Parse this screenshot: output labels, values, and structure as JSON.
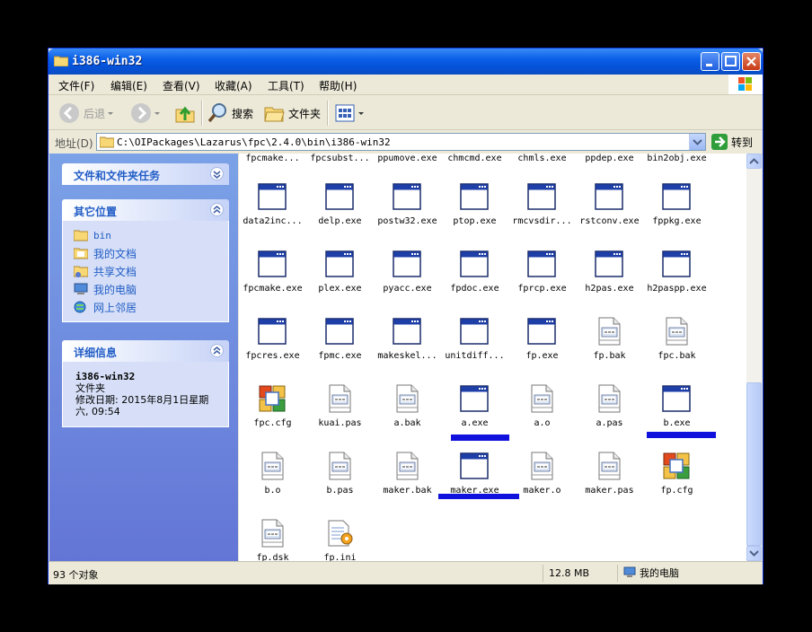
{
  "window": {
    "title": "i386-win32"
  },
  "menu": [
    "文件(F)",
    "编辑(E)",
    "查看(V)",
    "收藏(A)",
    "工具(T)",
    "帮助(H)"
  ],
  "toolbar": {
    "back": "后退",
    "search": "搜索",
    "folders": "文件夹"
  },
  "address": {
    "label": "地址(D)",
    "path": "C:\\OIPackages\\Lazarus\\fpc\\2.4.0\\bin\\i386-win32",
    "go": "转到"
  },
  "left": {
    "tasks_title": "文件和文件夹任务",
    "places_title": "其它位置",
    "places": [
      "bin",
      "我的文档",
      "共享文档",
      "我的电脑",
      "网上邻居"
    ],
    "details_title": "详细信息",
    "details": {
      "name": "i386-win32",
      "type": "文件夹",
      "modified": "修改日期: 2015年8月1日星期六, 09:54"
    }
  },
  "files_partial": [
    "fpcmake...",
    "fpcsubst...",
    "ppumove.exe",
    "chmcmd.exe",
    "chmls.exe",
    "ppdep.exe",
    "bin2obj.exe"
  ],
  "files": [
    {
      "name": "data2inc...",
      "type": "exe"
    },
    {
      "name": "delp.exe",
      "type": "exe"
    },
    {
      "name": "postw32.exe",
      "type": "exe"
    },
    {
      "name": "ptop.exe",
      "type": "exe"
    },
    {
      "name": "rmcvsdir...",
      "type": "exe"
    },
    {
      "name": "rstconv.exe",
      "type": "exe"
    },
    {
      "name": "fppkg.exe",
      "type": "exe"
    },
    {
      "name": "fpcmake.exe",
      "type": "exe"
    },
    {
      "name": "plex.exe",
      "type": "exe"
    },
    {
      "name": "pyacc.exe",
      "type": "exe"
    },
    {
      "name": "fpdoc.exe",
      "type": "exe"
    },
    {
      "name": "fprcp.exe",
      "type": "exe"
    },
    {
      "name": "h2pas.exe",
      "type": "exe"
    },
    {
      "name": "h2paspp.exe",
      "type": "exe"
    },
    {
      "name": "fpcres.exe",
      "type": "exe"
    },
    {
      "name": "fpmc.exe",
      "type": "exe"
    },
    {
      "name": "makeskel...",
      "type": "exe"
    },
    {
      "name": "unitdiff...",
      "type": "exe"
    },
    {
      "name": "fp.exe",
      "type": "exe"
    },
    {
      "name": "fp.bak",
      "type": "doc"
    },
    {
      "name": "fpc.bak",
      "type": "doc"
    },
    {
      "name": "fpc.cfg",
      "type": "cfg"
    },
    {
      "name": "kuai.pas",
      "type": "doc"
    },
    {
      "name": "a.bak",
      "type": "doc"
    },
    {
      "name": "a.exe",
      "type": "exe"
    },
    {
      "name": "a.o",
      "type": "doc"
    },
    {
      "name": "a.pas",
      "type": "doc"
    },
    {
      "name": "b.exe",
      "type": "exe"
    },
    {
      "name": "b.o",
      "type": "doc"
    },
    {
      "name": "b.pas",
      "type": "doc"
    },
    {
      "name": "maker.bak",
      "type": "doc"
    },
    {
      "name": "maker.exe",
      "type": "exe"
    },
    {
      "name": "maker.o",
      "type": "doc"
    },
    {
      "name": "maker.pas",
      "type": "doc"
    },
    {
      "name": "fp.cfg",
      "type": "cfg"
    },
    {
      "name": "fp.dsk",
      "type": "doc"
    },
    {
      "name": "fp.ini",
      "type": "ini"
    }
  ],
  "status": {
    "count": "93 个对象",
    "size": "12.8 MB",
    "location": "我的电脑"
  },
  "colors": {
    "titlebar": "#0553D9",
    "taskpane": "#6375D6",
    "highlight_marks": "#1111DD"
  }
}
